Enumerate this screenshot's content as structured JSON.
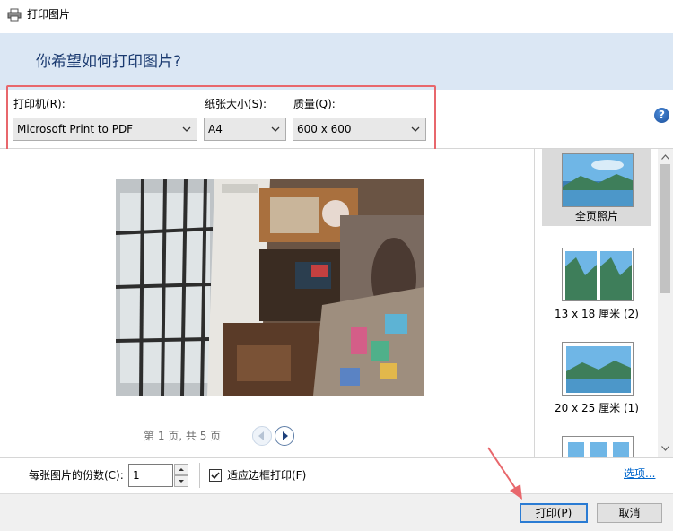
{
  "window": {
    "title": "打印图片"
  },
  "header": {
    "question": "你希望如何打印图片?"
  },
  "printer": {
    "label": "打印机(R):",
    "value": "Microsoft Print to PDF"
  },
  "paper_size": {
    "label": "纸张大小(S):",
    "value": "A4"
  },
  "quality": {
    "label": "质量(Q):",
    "value": "600 x 600"
  },
  "help": {
    "glyph": "?"
  },
  "preview": {
    "page_indicator": "第 1 页, 共 5 页"
  },
  "layouts": [
    {
      "label": "全页照片",
      "selected": true
    },
    {
      "label": "13 x 18 厘米 (2)",
      "selected": false
    },
    {
      "label": "20 x 25 厘米 (1)",
      "selected": false
    }
  ],
  "copies": {
    "label": "每张图片的份数(C):",
    "value": "1"
  },
  "fit_frame": {
    "label": "适应边框打印(F)",
    "checked": true
  },
  "options_link": "选项...",
  "buttons": {
    "print": "打印(P)",
    "cancel": "取消"
  },
  "colors": {
    "accent": "#2a7bd3",
    "highlight": "#e8676c",
    "header_bg": "#dbe7f4"
  }
}
